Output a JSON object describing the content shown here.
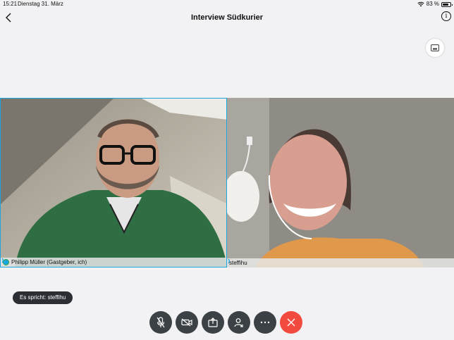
{
  "status": {
    "time": "15:21",
    "date": "Dienstag 31. März",
    "battery": "83 %",
    "battery_level": 0.83
  },
  "nav": {
    "title": "Interview Südkurier"
  },
  "participants": [
    {
      "name": "Philipp Müller (Gastgeber, ich)"
    },
    {
      "name": "steffihu"
    }
  ],
  "speaking": {
    "text": "Es spricht: steffihu"
  },
  "colors": {
    "accent": "#1aa6e0",
    "end_call": "#f24a3e",
    "control": "#3c4145"
  },
  "controls": [
    "mic-muted-icon",
    "video-off-icon",
    "share-icon",
    "participants-icon",
    "more-icon",
    "end-call-icon"
  ]
}
